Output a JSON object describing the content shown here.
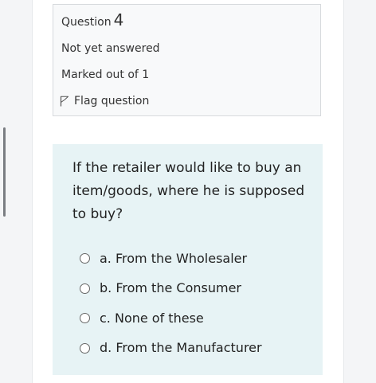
{
  "question_info": {
    "label": "Question",
    "number": "4",
    "status": "Not yet answered",
    "marks": "Marked out of 1",
    "flag_label": "Flag question",
    "flag_icon": "flag-icon"
  },
  "question": {
    "text": "If the retailer would like to buy an item/goods, where he is supposed to buy?",
    "options": [
      {
        "label": "a. From the Wholesaler"
      },
      {
        "label": "b. From the Consumer"
      },
      {
        "label": "c. None of these"
      },
      {
        "label": "d. From the Manufacturer"
      }
    ]
  },
  "colors": {
    "question_bg": "#e7f3f5",
    "info_bg": "#f8f9fa",
    "page_bg": "#f4f5f7"
  }
}
